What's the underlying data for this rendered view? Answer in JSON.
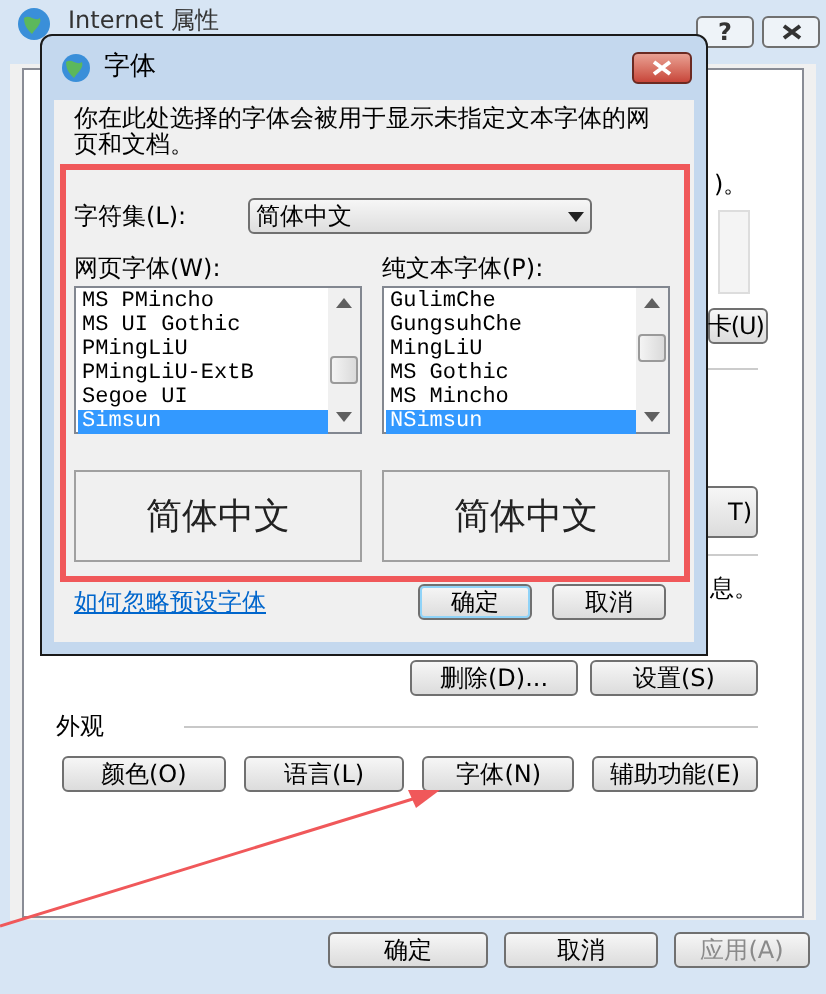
{
  "window": {
    "title": "Internet 属性",
    "help_button": "?"
  },
  "background": {
    "partial_text": ")。",
    "partial_button_1": "卡(U)",
    "partial_button_2": "T)",
    "partial_note": "息。"
  },
  "actions": [
    {
      "label": "删除(D)..."
    },
    {
      "label": "设置(S)"
    }
  ],
  "appearance": {
    "heading": "外观",
    "buttons": [
      {
        "label": "颜色(O)"
      },
      {
        "label": "语言(L)"
      },
      {
        "label": "字体(N)"
      },
      {
        "label": "辅助功能(E)"
      }
    ]
  },
  "footer_buttons": [
    {
      "label": "确定",
      "disabled": false
    },
    {
      "label": "取消",
      "disabled": false
    },
    {
      "label": "应用(A)",
      "disabled": true
    }
  ],
  "dialog": {
    "title": "字体",
    "description": "你在此处选择的字体会被用于显示未指定文本字体的网页和文档。",
    "charset": {
      "label": "字符集(L):",
      "value": "简体中文"
    },
    "web_font": {
      "label": "网页字体(W):",
      "items": [
        {
          "text": "MS PMincho",
          "selected": false
        },
        {
          "text": "MS UI Gothic",
          "selected": false
        },
        {
          "text": "PMingLiU",
          "selected": false
        },
        {
          "text": "PMingLiU-ExtB",
          "selected": false
        },
        {
          "text": "Segoe UI",
          "selected": false
        },
        {
          "text": "Simsun",
          "selected": true
        }
      ],
      "preview": "简体中文"
    },
    "plain_font": {
      "label": "纯文本字体(P):",
      "items": [
        {
          "text": "GulimChe",
          "selected": false
        },
        {
          "text": "GungsuhChe",
          "selected": false
        },
        {
          "text": "MingLiU",
          "selected": false
        },
        {
          "text": "MS Gothic",
          "selected": false
        },
        {
          "text": "MS Mincho",
          "selected": false
        },
        {
          "text": "NSimsun",
          "selected": true
        }
      ],
      "preview": "简体中文"
    },
    "link": "如何忽略预设字体",
    "buttons": [
      {
        "label": "确定",
        "default": true
      },
      {
        "label": "取消",
        "default": false
      }
    ]
  }
}
